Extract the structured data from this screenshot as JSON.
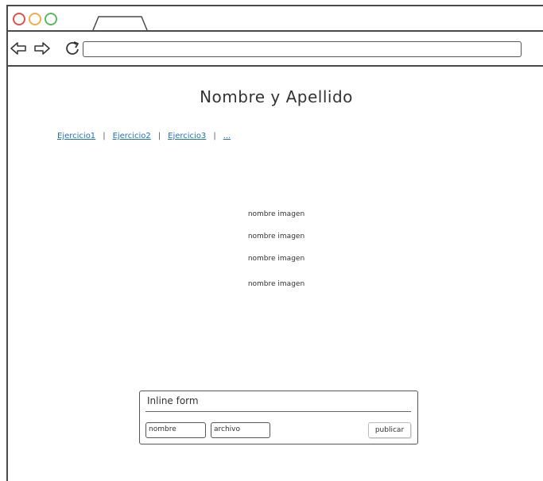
{
  "browser": {
    "controls": [
      "close-dot",
      "minimize-dot",
      "maximize-dot"
    ],
    "url": ""
  },
  "page": {
    "title": "Nombre y Apellido",
    "nav_links": [
      "Ejercicio1",
      "Ejercicio2",
      "Ejercicio3",
      "..."
    ],
    "nav_separator": "|",
    "image_labels": [
      "nombre imagen",
      "nombre imagen",
      "nombre imagen",
      "nombre imagen"
    ]
  },
  "form": {
    "title": "Inline form",
    "nombre_value": "nombre",
    "archivo_value": "archivo",
    "submit_label": "publicar"
  },
  "colors": {
    "link": "#1f6fc4",
    "close": "#d9534f",
    "minimize": "#f0ad4e",
    "maximize": "#5cb85c"
  }
}
